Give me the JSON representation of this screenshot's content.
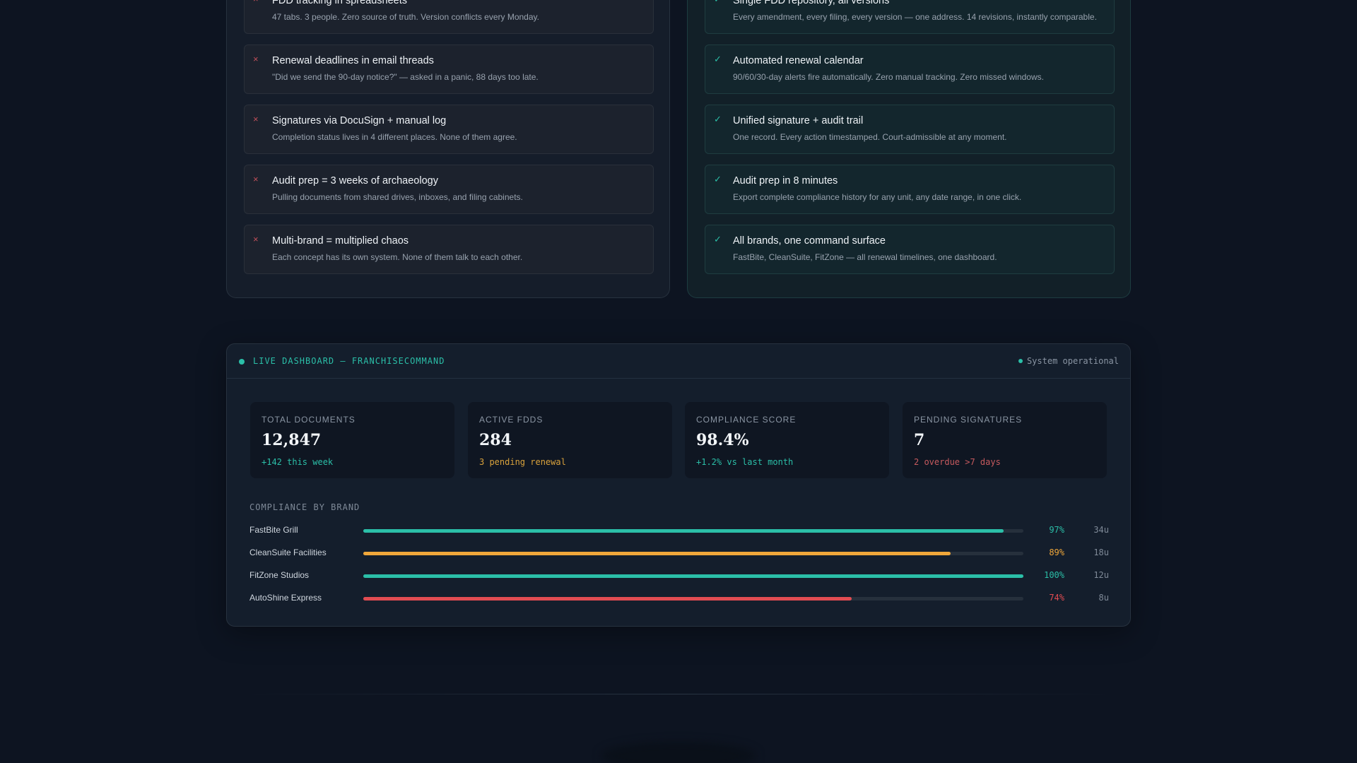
{
  "before": {
    "items": [
      {
        "title": "FDD tracking in spreadsheets",
        "desc": "47 tabs. 3 people. Zero source of truth. Version conflicts every Monday."
      },
      {
        "title": "Renewal deadlines in email threads",
        "desc": "\"Did we send the 90-day notice?\" — asked in a panic, 88 days too late."
      },
      {
        "title": "Signatures via DocuSign + manual log",
        "desc": "Completion status lives in 4 different places. None of them agree."
      },
      {
        "title": "Audit prep = 3 weeks of archaeology",
        "desc": "Pulling documents from shared drives, inboxes, and filing cabinets."
      },
      {
        "title": "Multi-brand = multiplied chaos",
        "desc": "Each concept has its own system. None of them talk to each other."
      }
    ]
  },
  "after": {
    "items": [
      {
        "title": "Single FDD repository, all versions",
        "desc": "Every amendment, every filing, every version — one address. 14 revisions, instantly comparable."
      },
      {
        "title": "Automated renewal calendar",
        "desc": "90/60/30-day alerts fire automatically. Zero manual tracking. Zero missed windows."
      },
      {
        "title": "Unified signature + audit trail",
        "desc": "One record. Every action timestamped. Court-admissible at any moment."
      },
      {
        "title": "Audit prep in 8 minutes",
        "desc": "Export complete compliance history for any unit, any date range, in one click."
      },
      {
        "title": "All brands, one command surface",
        "desc": "FastBite, CleanSuite, FitZone — all renewal timelines, one dashboard."
      }
    ]
  },
  "icons": {
    "bad": "×",
    "good": "✓",
    "bad_name": "x-icon",
    "good_name": "check-icon"
  },
  "dashboard": {
    "title": "LIVE DASHBOARD — FRANCHISECOMMAND",
    "status": "System operational",
    "cards": [
      {
        "label": "TOTAL DOCUMENTS",
        "value": "12,847",
        "sub": "+142 this week",
        "sub_color": "#2bbfa8"
      },
      {
        "label": "ACTIVE FDDS",
        "value": "284",
        "sub": "3 pending renewal",
        "sub_color": "#d9a23c"
      },
      {
        "label": "COMPLIANCE SCORE",
        "value": "98.4%",
        "sub": "+1.2% vs last month",
        "sub_color": "#2bbfa8"
      },
      {
        "label": "PENDING SIGNATURES",
        "value": "7",
        "sub": "2 overdue >7 days",
        "sub_color": "#c65a5e"
      }
    ],
    "section_label": "COMPLIANCE BY BRAND",
    "brands": [
      {
        "name": "FastBite Grill",
        "percent": 97,
        "percent_label": "97%",
        "units": "34u",
        "color": "#2bbfa8"
      },
      {
        "name": "CleanSuite Facilities",
        "percent": 89,
        "percent_label": "89%",
        "units": "18u",
        "color": "#f0a73a"
      },
      {
        "name": "FitZone Studios",
        "percent": 100,
        "percent_label": "100%",
        "units": "12u",
        "color": "#2bbfa8"
      },
      {
        "name": "AutoShine Express",
        "percent": 74,
        "percent_label": "74%",
        "units": "8u",
        "color": "#e24c52"
      }
    ]
  },
  "colors": {
    "background": "#0d1421",
    "accent": "#2bbfa8",
    "warning": "#f0a73a",
    "danger": "#e24c52"
  }
}
